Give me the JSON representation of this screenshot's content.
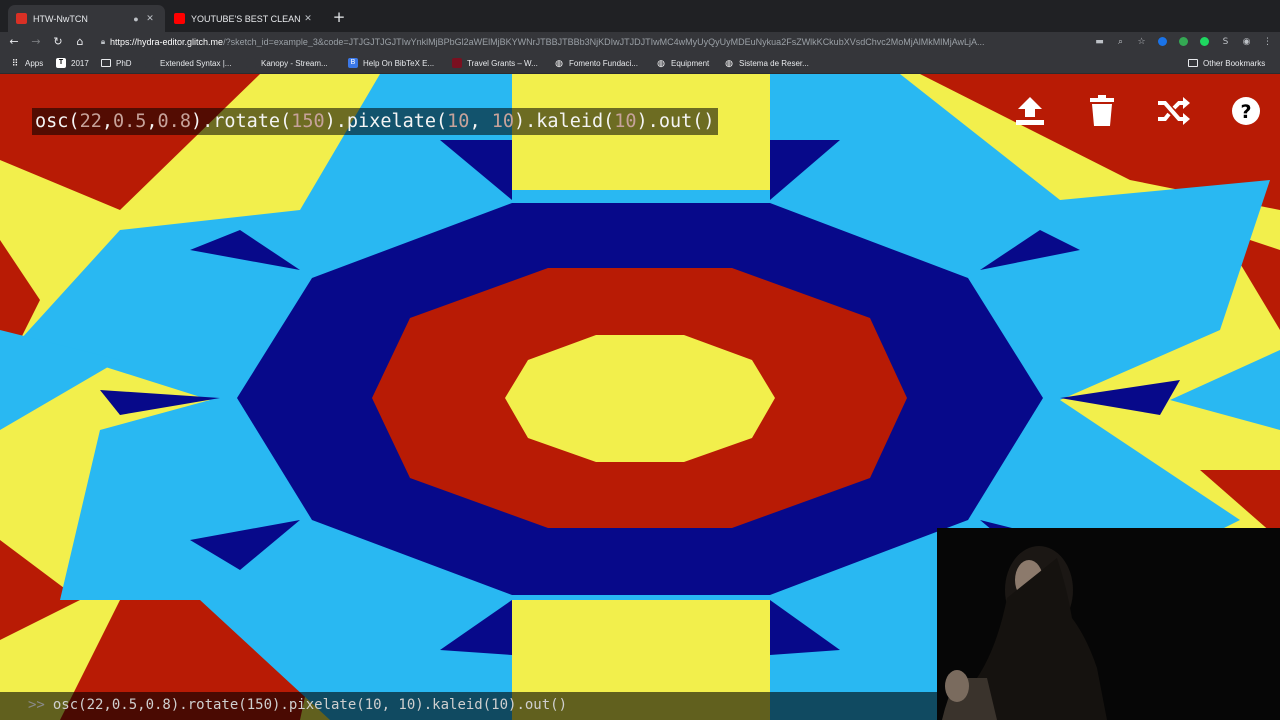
{
  "browser": {
    "tabs": [
      {
        "title": "HTW-NwTCN",
        "favicon_color": "#d93025",
        "active": true
      },
      {
        "title": "YOUTUBE'S BEST CLEAN ME",
        "favicon_color": "#ff0000",
        "active": false
      }
    ],
    "address": {
      "host": "https://hydra-editor.glitch.me",
      "path": "/?sketch_id=example_3&code=JTJGJTJGJTIwYnklMjBPbGl2aWElMjBKYWNrJTBBJTBBb3NjKDIwJTJDJTIwMC4wMyUyQyUyMDEuNykua2FsZWlkKCkubXVsdChvc2MoMjAlMkMlMjAwLjA..."
    },
    "bookmarks": [
      {
        "label": "Apps",
        "icon": "apps-grid-icon"
      },
      {
        "label": "2017",
        "icon": "bookmark-site-icon"
      },
      {
        "label": "PhD",
        "icon": "folder-icon"
      },
      {
        "label": "Extended Syntax |...",
        "icon": "bookmark-site-icon"
      },
      {
        "label": "Kanopy - Stream...",
        "icon": "bookmark-site-icon"
      },
      {
        "label": "Help On BibTeX E...",
        "icon": "bookmark-site-icon"
      },
      {
        "label": "Travel Grants – W...",
        "icon": "bookmark-site-icon"
      },
      {
        "label": "Fomento Fundaci...",
        "icon": "globe-icon"
      },
      {
        "label": "Equipment",
        "icon": "globe-icon"
      },
      {
        "label": "Sistema de Reser...",
        "icon": "globe-icon"
      },
      {
        "label": "Other Bookmarks",
        "icon": "folder-icon"
      }
    ]
  },
  "editor": {
    "code": {
      "t1": "osc(",
      "n1": "22",
      "t2": ",",
      "n2": "0.5",
      "t3": ",",
      "n3": "0.8",
      "t4": ").rotate(",
      "n4": "150",
      "t5": ").pixelate(",
      "n5": "10",
      "t6": ", ",
      "n6": "10",
      "t7": ").kaleid(",
      "n7": "10",
      "t8": ").out()"
    },
    "console": {
      "prompt": ">>",
      "text": "osc(22,0.5,0.8).rotate(150).pixelate(10, 10).kaleid(10).out()"
    },
    "buttons": [
      "upload-icon",
      "trash-icon",
      "shuffle-icon",
      "help-icon"
    ],
    "colors": {
      "yellow": "#f2ef4c",
      "light_blue": "#29b8f2",
      "navy": "#07098a",
      "red": "#b81b05"
    }
  }
}
